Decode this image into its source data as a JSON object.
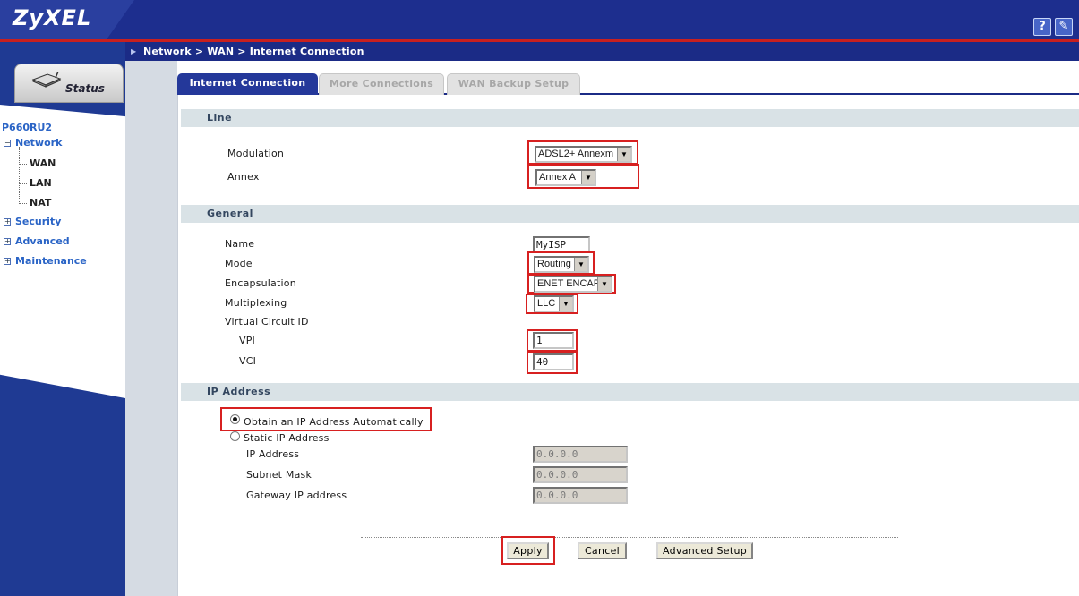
{
  "header": {
    "logo": "ZyXEL",
    "help_icon": "question-icon",
    "tool_icon": "wrench-icon",
    "help_label": "?",
    "tool_label": "✎"
  },
  "breadcrumb": "Network > WAN > Internet Connection",
  "sidebar": {
    "status_label": "Status",
    "device": "P660RU2",
    "network": "Network",
    "network_items": [
      "WAN",
      "LAN",
      "NAT"
    ],
    "security": "Security",
    "advanced": "Advanced",
    "maintenance": "Maintenance"
  },
  "tabs": [
    "Internet Connection",
    "More Connections",
    "WAN Backup Setup"
  ],
  "line": {
    "title": "Line",
    "modulation_label": "Modulation",
    "modulation_value": "ADSL2+ Annexm",
    "annex_label": "Annex",
    "annex_value": "Annex A"
  },
  "general": {
    "title": "General",
    "name_label": "Name",
    "name_value": "MyISP",
    "mode_label": "Mode",
    "mode_value": "Routing",
    "encapsulation_label": "Encapsulation",
    "encapsulation_value": "ENET ENCAP",
    "multiplexing_label": "Multiplexing",
    "multiplexing_value": "LLC",
    "vc_label": "Virtual Circuit ID",
    "vpi_label": "VPI",
    "vpi_value": "1",
    "vci_label": "VCI",
    "vci_value": "40"
  },
  "ip": {
    "title": "IP Address",
    "auto_label": "Obtain an IP Address Automatically",
    "static_label": "Static IP Address",
    "ip_label": "IP Address",
    "ip_value": "0.0.0.0",
    "mask_label": "Subnet Mask",
    "mask_value": "0.0.0.0",
    "gateway_label": "Gateway IP address",
    "gateway_value": "0.0.0.0"
  },
  "buttons": {
    "apply": "Apply",
    "cancel": "Cancel",
    "advanced": "Advanced Setup"
  },
  "colors": {
    "banner": "#1d2e8e",
    "accent_red": "#d72020",
    "nav_blue": "#2a64c6",
    "section_bg": "#d9e2e6"
  }
}
